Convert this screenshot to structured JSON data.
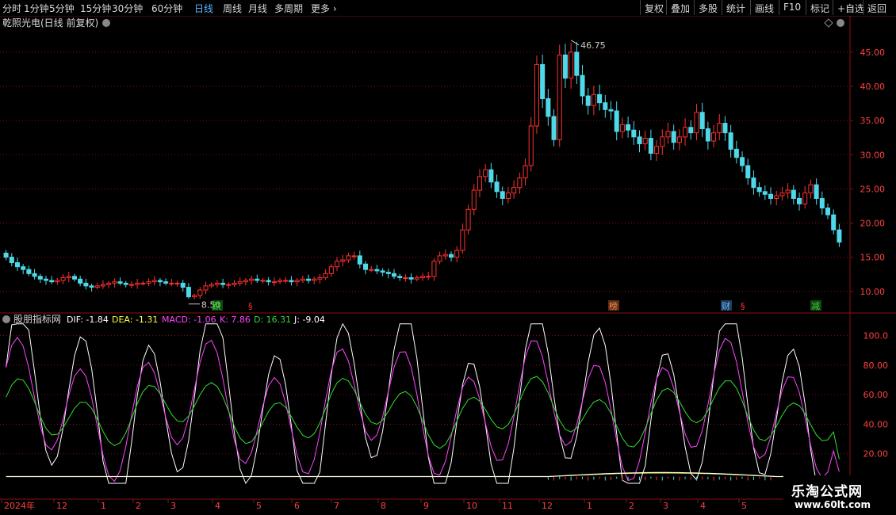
{
  "toolbar": {
    "periods": [
      "分时",
      "1分钟",
      "5分钟",
      "15分钟",
      "30分钟",
      "60分钟",
      "日线",
      "周线",
      "月线",
      "多周期",
      "更多"
    ],
    "active_period": "日线",
    "buttons": [
      "复权",
      "叠加",
      "多股",
      "统计",
      "画线",
      "F10",
      "标记",
      "+自选",
      "返回"
    ]
  },
  "chart_header": {
    "title": "乾照光电(日线 前复权)"
  },
  "indicator_header": {
    "name": "股朋指标网",
    "dif": "DIF: -1.84",
    "dea": "DEA: -1.31",
    "macd": "MACD: -1.06",
    "k": "K: 7.86",
    "d": "D: 16.31",
    "j": "J: -9.04"
  },
  "colors": {
    "up": "#ff3030",
    "down": "#4ed8e8",
    "grid": "#8a1010",
    "k": "#ff44ff",
    "d": "#33dd33",
    "j": "#ffffff",
    "dif": "#ffffff",
    "dea": "#ffff44"
  },
  "annotations": {
    "high": "46.75",
    "low": "8.50"
  },
  "event_markers": [
    {
      "text": "跌",
      "color": "#33cc33"
    },
    {
      "text": "§",
      "color": "#ff3030"
    },
    {
      "text": "榜",
      "color": "#ff8844"
    },
    {
      "text": "财",
      "color": "#5fb3ff"
    },
    {
      "text": "§",
      "color": "#ff3030"
    },
    {
      "text": "减",
      "color": "#33cc33"
    }
  ],
  "price_axis": [
    "45.00",
    "40.00",
    "35.00",
    "30.00",
    "25.00",
    "20.00",
    "15.00",
    "10.00"
  ],
  "indicator_axis": [
    "100.0",
    "80.00",
    "60.00",
    "40.00",
    "20.00"
  ],
  "date_axis": [
    "2024年",
    "12",
    "1",
    "2",
    "3",
    "4",
    "5",
    "6",
    "7",
    "8",
    "9",
    "10",
    "11",
    "12",
    "1",
    "2",
    "3",
    "4",
    "5"
  ],
  "watermark": {
    "line1": "乐淘公式网",
    "line2": "www.60lt.com"
  },
  "chart_data": {
    "type": "candlestick",
    "price_close": [
      15.0,
      14.2,
      13.6,
      13.2,
      12.6,
      12.2,
      11.8,
      11.6,
      11.4,
      11.6,
      12.0,
      12.2,
      11.8,
      11.2,
      10.8,
      10.6,
      10.8,
      11.0,
      11.2,
      11.4,
      11.2,
      11.0,
      11.0,
      11.2,
      11.2,
      11.4,
      11.6,
      11.4,
      11.2,
      11.2,
      11.2,
      10.6,
      9.2,
      9.4,
      10.2,
      10.8,
      11.0,
      11.2,
      11.0,
      11.0,
      11.2,
      11.4,
      11.6,
      11.8,
      11.6,
      11.6,
      11.4,
      11.4,
      11.6,
      11.6,
      11.4,
      11.6,
      11.8,
      11.6,
      11.8,
      12.0,
      12.6,
      13.6,
      14.4,
      14.6,
      15.2,
      15.2,
      14.0,
      13.2,
      13.2,
      13.0,
      12.8,
      12.6,
      12.2,
      12.0,
      12.0,
      11.8,
      12.0,
      12.2,
      12.2,
      14.4,
      15.2,
      15.4,
      15.0,
      16.0,
      19.0,
      22.0,
      24.8,
      26.8,
      27.8,
      26.0,
      24.6,
      23.6,
      24.4,
      25.2,
      26.6,
      28.4,
      34.2,
      43.2,
      38.2,
      35.6,
      32.2,
      44.6,
      41.2,
      45.0,
      41.6,
      38.6,
      37.2,
      38.8,
      37.6,
      36.6,
      36.4,
      33.4,
      34.4,
      33.6,
      32.6,
      31.6,
      32.4,
      30.2,
      31.2,
      32.6,
      33.4,
      31.8,
      32.6,
      34.0,
      33.2,
      36.2,
      33.8,
      32.0,
      33.2,
      34.6,
      33.2,
      30.8,
      29.6,
      28.4,
      26.6,
      25.2,
      24.6,
      24.2,
      23.6,
      24.0,
      24.4,
      24.8,
      23.6,
      22.8,
      24.4,
      25.6,
      23.6,
      22.2,
      21.2,
      19.0,
      17.2
    ],
    "ylim": [
      8.0,
      48.0
    ],
    "indicator": {
      "k_last": 7.86,
      "d_last": 16.31,
      "j_last": -9.04,
      "dif_last": -1.84,
      "dea_last": -1.31,
      "macd_last": -1.06,
      "ylim": [
        0,
        110
      ]
    }
  }
}
